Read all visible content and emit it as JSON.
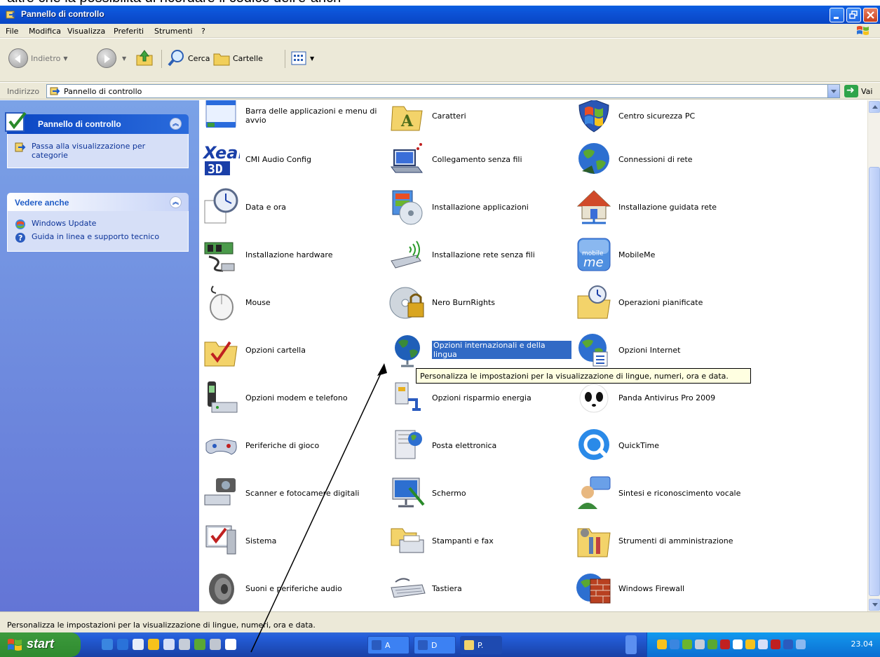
{
  "caption": {
    "text": "altre che la possibilità di ricordare il codice dell'e-anch"
  },
  "window": {
    "title": "Pannello di controllo",
    "colors": {
      "titlebar": "#0a5fe0",
      "taskpane": "#6f8ee0",
      "selection": "#316ac5"
    }
  },
  "menu": {
    "items": [
      "File",
      "Modifica",
      "Visualizza",
      "Preferiti",
      "Strumenti",
      "?"
    ]
  },
  "toolbar": {
    "back_label": "Indietro",
    "search_label": "Cerca",
    "folders_label": "Cartelle"
  },
  "address": {
    "label": "Indirizzo",
    "value": "Pannello di controllo",
    "go_label": "Vai"
  },
  "taskpane": {
    "control_panel": {
      "title": "Pannello di controllo",
      "link": "Passa alla visualizzazione per categorie"
    },
    "see_also": {
      "title": "Vedere anche",
      "links": [
        "Windows Update",
        "Guida in linea e supporto tecnico"
      ]
    }
  },
  "items": [
    {
      "label": "Barra delle applicazioni e menu di avvio",
      "icon": "taskbar-icon"
    },
    {
      "label": "Caratteri",
      "icon": "fonts-folder-icon"
    },
    {
      "label": "Centro sicurezza PC",
      "icon": "security-shield-icon"
    },
    {
      "label": "CMI Audio Config",
      "icon": "xear-audio-icon"
    },
    {
      "label": "Collegamento senza fili",
      "icon": "wireless-laptop-icon"
    },
    {
      "label": "Connessioni di rete",
      "icon": "network-globe-icon"
    },
    {
      "label": "Data e ora",
      "icon": "clock-icon"
    },
    {
      "label": "Installazione applicazioni",
      "icon": "install-apps-icon"
    },
    {
      "label": "Installazione guidata rete",
      "icon": "home-network-icon"
    },
    {
      "label": "Installazione hardware",
      "icon": "hardware-icon"
    },
    {
      "label": "Installazione rete senza fili",
      "icon": "wireless-stick-icon"
    },
    {
      "label": "MobileMe",
      "icon": "mobileme-icon"
    },
    {
      "label": "Mouse",
      "icon": "mouse-icon"
    },
    {
      "label": "Nero BurnRights",
      "icon": "nero-lock-icon"
    },
    {
      "label": "Operazioni pianificate",
      "icon": "scheduled-tasks-icon"
    },
    {
      "label": "Opzioni cartella",
      "icon": "folder-options-icon"
    },
    {
      "label": "Opzioni internazionali e della lingua",
      "icon": "globe-icon",
      "selected": true
    },
    {
      "label": "Opzioni Internet",
      "icon": "internet-options-icon"
    },
    {
      "label": "Opzioni modem e telefono",
      "icon": "phone-modem-icon"
    },
    {
      "label": "Opzioni risparmio energia",
      "icon": "power-plug-icon"
    },
    {
      "label": "Panda Antivirus Pro 2009",
      "icon": "panda-icon"
    },
    {
      "label": "Periferiche di gioco",
      "icon": "gamepad-icon"
    },
    {
      "label": "Posta elettronica",
      "icon": "mail-icon"
    },
    {
      "label": "QuickTime",
      "icon": "quicktime-icon"
    },
    {
      "label": "Scanner e fotocamere digitali",
      "icon": "scanner-camera-icon"
    },
    {
      "label": "Schermo",
      "icon": "display-icon"
    },
    {
      "label": "Sintesi e riconoscimento vocale",
      "icon": "speech-icon"
    },
    {
      "label": "Sistema",
      "icon": "system-icon"
    },
    {
      "label": "Stampanti e fax",
      "icon": "printer-icon"
    },
    {
      "label": "Strumenti di amministrazione",
      "icon": "admin-tools-icon"
    },
    {
      "label": "Suoni e periferiche audio",
      "icon": "speaker-icon"
    },
    {
      "label": "Tastiera",
      "icon": "keyboard-icon"
    },
    {
      "label": "Windows Firewall",
      "icon": "firewall-icon"
    }
  ],
  "tooltip": "Personalizza le impostazioni per la visualizzazione di lingue, numeri, ora e data.",
  "status": "Personalizza le impostazioni per la visualizzazione di lingue, numeri, ora e data.",
  "taskbar": {
    "start_label": "start",
    "buttons": [
      "A",
      "D",
      "P."
    ],
    "clock": "23.04"
  }
}
